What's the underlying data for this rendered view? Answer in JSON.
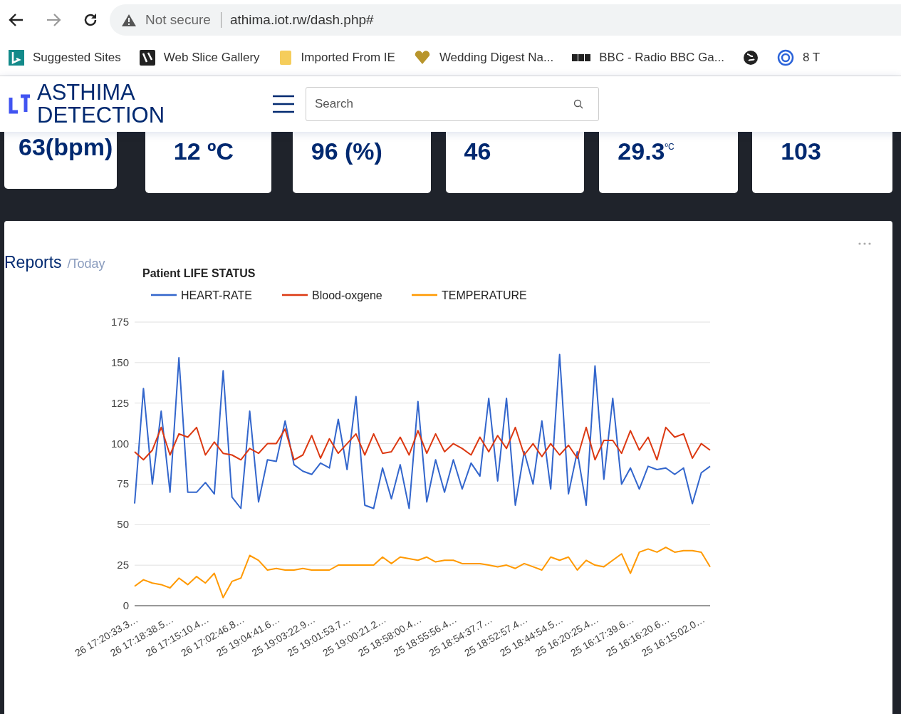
{
  "browser": {
    "security": "Not secure",
    "url": "athima.iot.rw/dash.php#"
  },
  "bookmarks": [
    {
      "label": "Suggested Sites",
      "kind": "bing"
    },
    {
      "label": "Web Slice Gallery",
      "kind": "slice"
    },
    {
      "label": "Imported From IE",
      "kind": "folder"
    },
    {
      "label": "Wedding Digest Na...",
      "kind": "heart"
    },
    {
      "label": "BBC - Radio BBC Ga...",
      "kind": "bbc"
    },
    {
      "kind": "globe"
    },
    {
      "label": "8 T",
      "kind": "ring"
    }
  ],
  "brand": {
    "line1": "ASTHIMA",
    "line2": "DETECTION"
  },
  "search": {
    "placeholder": "Search"
  },
  "cards": [
    {
      "value": "63(bpm)"
    },
    {
      "value": "12 ºC"
    },
    {
      "value": "96 (%)"
    },
    {
      "value": "46"
    },
    {
      "value": "29.3$^{ºC}$"
    },
    {
      "value": "103"
    }
  ],
  "reports": {
    "title": "Reports",
    "period": "/Today",
    "chart_data": {
      "type": "line",
      "title": "Patient LIFE STATUS",
      "categories": [
        "26 17:20:33.3…",
        null,
        null,
        null,
        "26 17:18:38.5…",
        null,
        null,
        null,
        "26 17:15:10.4…",
        null,
        null,
        null,
        "26 17:02:46.8…",
        null,
        null,
        null,
        "25 19:04:41.6…",
        null,
        null,
        null,
        "25 19:03:22.9…",
        null,
        null,
        null,
        "25 19:01:53.7…",
        null,
        null,
        null,
        "25 19:00:21.2…",
        null,
        null,
        null,
        "25 18:58:00.4…",
        null,
        null,
        null,
        "25 18:55:56.4…",
        null,
        null,
        null,
        "25 18:54:37.7…",
        null,
        null,
        null,
        "25 18:52:57.4…",
        null,
        null,
        null,
        "25 18:44:54.5…",
        null,
        null,
        null,
        "25 16:20:25.4…",
        null,
        null,
        null,
        "25 16:17:39.6…",
        null,
        null,
        null,
        "25 16:16:20.6…",
        null,
        null,
        null,
        "25 16:15:02.0…",
        null
      ],
      "grid": true,
      "legend": "top",
      "ylim": [
        0,
        175
      ],
      "yticks": [
        0,
        25,
        50,
        75,
        100,
        125,
        150,
        175
      ],
      "series": [
        {
          "name": "HEART-RATE",
          "color": "#3366cc",
          "values": [
            63,
            134,
            75,
            120,
            70,
            153,
            70,
            70,
            76,
            69,
            145,
            67,
            60,
            120,
            64,
            90,
            89,
            114,
            87,
            83,
            81,
            88,
            85,
            115,
            84,
            129,
            62,
            60,
            85,
            66,
            87,
            60,
            126,
            64,
            90,
            70,
            90,
            72,
            88,
            80,
            128,
            77,
            128,
            62,
            95,
            75,
            114,
            72,
            155,
            69,
            95,
            62,
            148,
            78,
            128,
            75,
            85,
            72,
            86,
            84,
            85,
            81,
            85,
            63,
            82,
            86
          ]
        },
        {
          "name": "Blood-oxgene",
          "color": "#dc3912",
          "values": [
            95,
            90,
            96,
            110,
            93,
            106,
            104,
            110,
            93,
            101,
            94,
            93,
            90,
            97,
            94,
            100,
            100,
            109,
            90,
            93,
            105,
            91,
            103,
            94,
            100,
            106,
            93,
            106,
            94,
            95,
            104,
            93,
            108,
            94,
            106,
            95,
            100,
            97,
            93,
            104,
            95,
            105,
            97,
            110,
            93,
            100,
            92,
            100,
            93,
            99,
            91,
            110,
            90,
            102,
            102,
            94,
            108,
            96,
            104,
            90,
            110,
            104,
            106,
            91,
            100,
            96
          ]
        },
        {
          "name": "TEMPERATURE",
          "color": "#ff9900",
          "values": [
            12,
            16,
            14,
            13,
            11,
            17,
            13,
            18,
            14,
            20,
            5,
            15,
            17,
            31,
            28,
            22,
            23,
            22,
            22,
            23,
            22,
            22,
            22,
            25,
            25,
            25,
            25,
            25,
            30,
            26,
            30,
            29,
            28,
            30,
            27,
            28,
            28,
            26,
            26,
            26,
            25,
            24,
            25,
            23,
            26,
            24,
            22,
            30,
            28,
            30,
            22,
            28,
            25,
            24,
            28,
            32,
            20,
            33,
            35,
            33,
            36,
            33,
            34,
            34,
            33,
            24
          ]
        }
      ]
    }
  }
}
